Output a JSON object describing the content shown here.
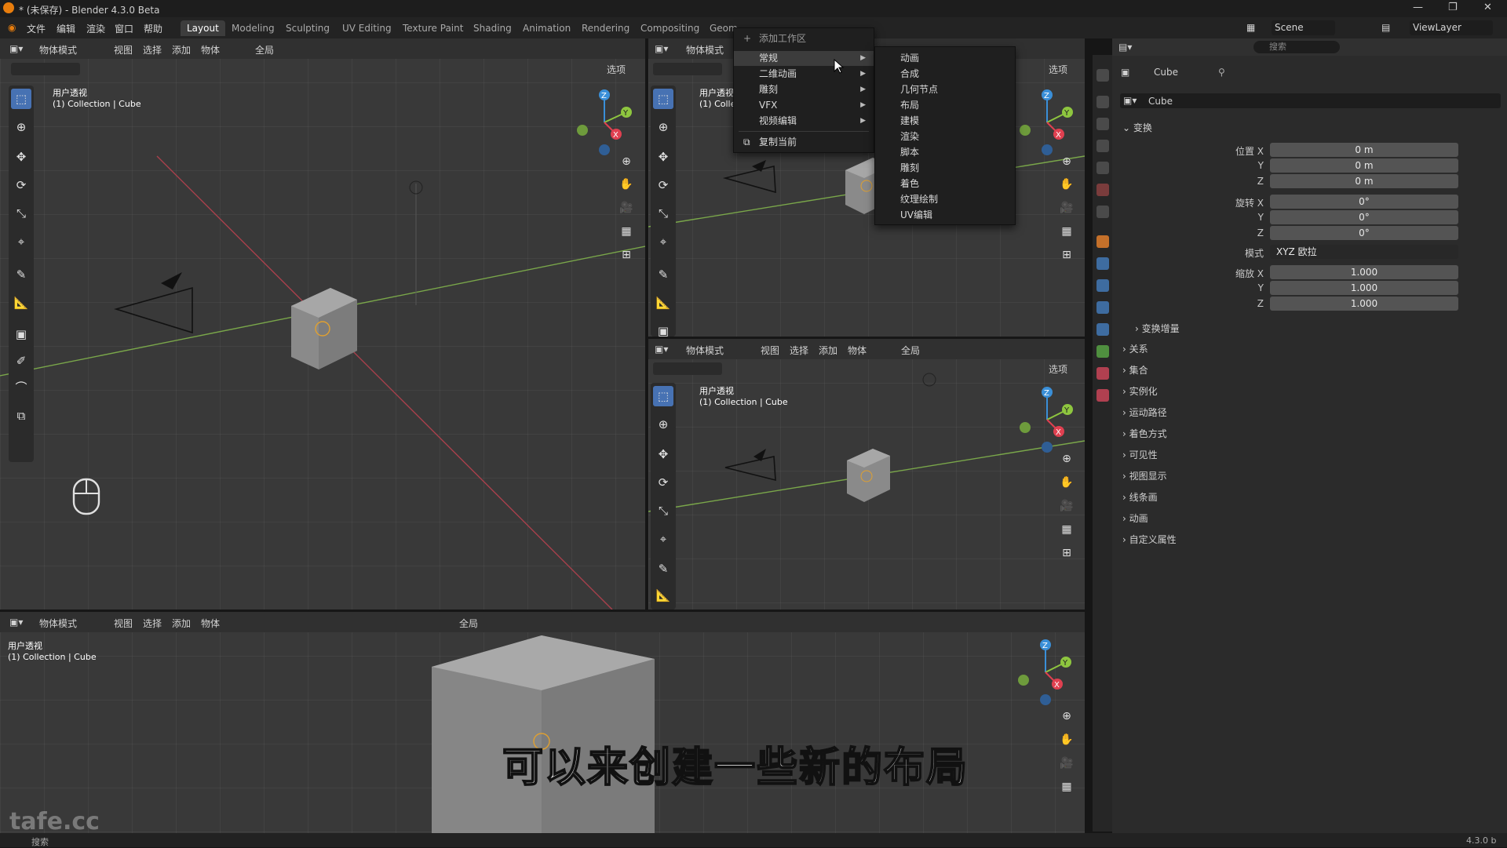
{
  "window": {
    "title": "* (未保存) - Blender 4.3.0 Beta"
  },
  "menu": {
    "file": "文件",
    "edit": "编辑",
    "render": "渲染",
    "window": "窗口",
    "help": "帮助"
  },
  "workspaces": [
    "Layout",
    "Modeling",
    "Sculpting",
    "UV Editing",
    "Texture Paint",
    "Shading",
    "Animation",
    "Rendering",
    "Compositing",
    "Geom"
  ],
  "scene": {
    "name": "Scene",
    "view_layer": "ViewLayer"
  },
  "viewport_header": {
    "mode": "物体模式",
    "view": "视图",
    "select": "选择",
    "add": "添加",
    "object": "物体",
    "global": "全局",
    "options": "选项"
  },
  "viewport": {
    "view_name": "用户透视",
    "collection": "(1) Collection | Cube",
    "view_name_short": "用户透视",
    "collection_short": "(1) Colle"
  },
  "workspace_menu": {
    "header": "添加工作区",
    "items": [
      "常规",
      "二维动画",
      "雕刻",
      "VFX",
      "视频编辑"
    ],
    "duplicate": "复制当前"
  },
  "submenu": {
    "items": [
      "动画",
      "合成",
      "几何节点",
      "布局",
      "建模",
      "渲染",
      "脚本",
      "雕刻",
      "着色",
      "纹理绘制",
      "UV编辑"
    ]
  },
  "properties": {
    "search_placeholder": "搜索",
    "object_name": "Cube",
    "data_name": "Cube",
    "transform": {
      "title": "变换",
      "location_label": "位置 X",
      "location": [
        "0 m",
        "0 m",
        "0 m"
      ],
      "rotation_label": "旋转 X",
      "rotation": [
        "0°",
        "0°",
        "0°"
      ],
      "mode_label": "模式",
      "mode": "XYZ 欧拉",
      "scale_label": "缩放 X",
      "scale": [
        "1.000",
        "1.000",
        "1.000"
      ],
      "y": "Y",
      "z": "Z",
      "delta": "变换增量"
    },
    "panels": [
      "关系",
      "集合",
      "实例化",
      "运动路径",
      "着色方式",
      "可见性",
      "视图显示",
      "线条画",
      "动画",
      "自定义属性"
    ]
  },
  "subtitle": "可以来创建一些新的布局",
  "watermark": "tafe.cc",
  "status": {
    "search": "搜索",
    "version": "4.3.0 b"
  },
  "colors": {
    "accent": "#4772b3",
    "background": "#393939",
    "header": "#303030",
    "x_axis": "#e04050",
    "y_axis": "#8ec63f",
    "z_axis": "#3a8fd8"
  }
}
